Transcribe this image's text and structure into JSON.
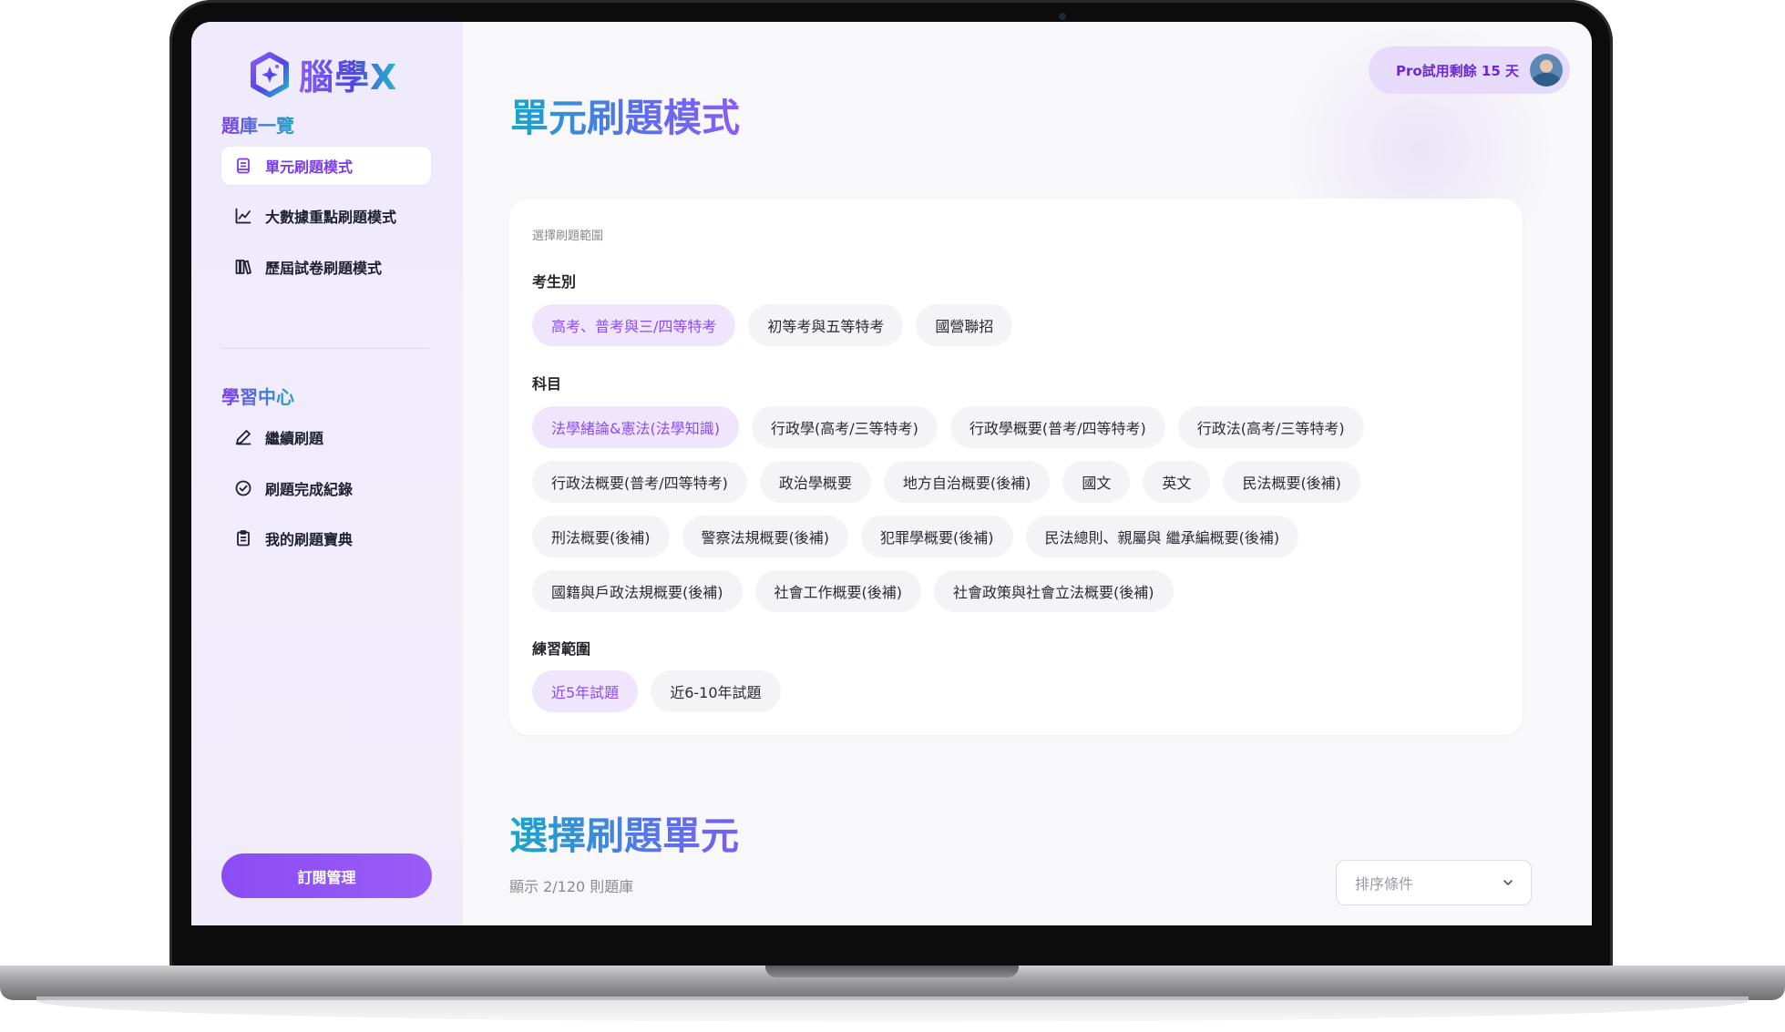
{
  "app": {
    "name": "腦學X",
    "brand_colors": {
      "primary": "#8b4cf4",
      "teal": "#1aa7c6",
      "chip_selected_bg": "#efe5fd"
    }
  },
  "sidebar": {
    "section1_title": "題庫一覽",
    "section1_items": [
      {
        "label": "單元刷題模式",
        "icon": "document-icon",
        "active": true
      },
      {
        "label": "大數據重點刷題模式",
        "icon": "line-chart-icon",
        "active": false
      },
      {
        "label": "歷屆試卷刷題模式",
        "icon": "books-icon",
        "active": false
      }
    ],
    "section2_title": "學習中心",
    "section2_items": [
      {
        "label": "繼續刷題",
        "icon": "pencil-icon"
      },
      {
        "label": "刷題完成紀錄",
        "icon": "check-circle-icon"
      },
      {
        "label": "我的刷題寶典",
        "icon": "clipboard-icon"
      }
    ],
    "subscribe_label": "訂閱管理"
  },
  "header": {
    "pro_label": "Pro試用剩餘 15 天",
    "avatar_icon": "user-avatar"
  },
  "main": {
    "page_title": "單元刷題模式",
    "filter": {
      "hint": "選擇刷題範圍",
      "exam_type": {
        "label": "考生別",
        "options": [
          "高考、普考與三/四等特考",
          "初等考與五等特考",
          "國營聯招"
        ],
        "selected": 0
      },
      "subject": {
        "label": "科目",
        "rows": [
          [
            "法學緒論&憲法(法學知識)",
            "行政學(高考/三等特考)",
            "行政學概要(普考/四等特考)",
            "行政法(高考/三等特考)"
          ],
          [
            "行政法概要(普考/四等特考)",
            "政治學概要",
            "地方自治概要(後補)",
            "國文",
            "英文",
            "民法概要(後補)"
          ],
          [
            "刑法概要(後補)",
            "警察法規概要(後補)",
            "犯罪學概要(後補)",
            "民法總則、親屬與 繼承編概要(後補)"
          ],
          [
            "國籍與戶政法規概要(後補)",
            "社會工作概要(後補)",
            "社會政策與社會立法概要(後補)"
          ]
        ],
        "selected": "法學緒論&憲法(法學知識)"
      },
      "range": {
        "label": "練習範圍",
        "options": [
          "近5年試題",
          "近6-10年試題"
        ],
        "selected": 0
      }
    },
    "unit_section": {
      "title": "選擇刷題單元",
      "count_text": "顯示 2/120 則題庫",
      "sort_placeholder": "排序條件"
    }
  }
}
